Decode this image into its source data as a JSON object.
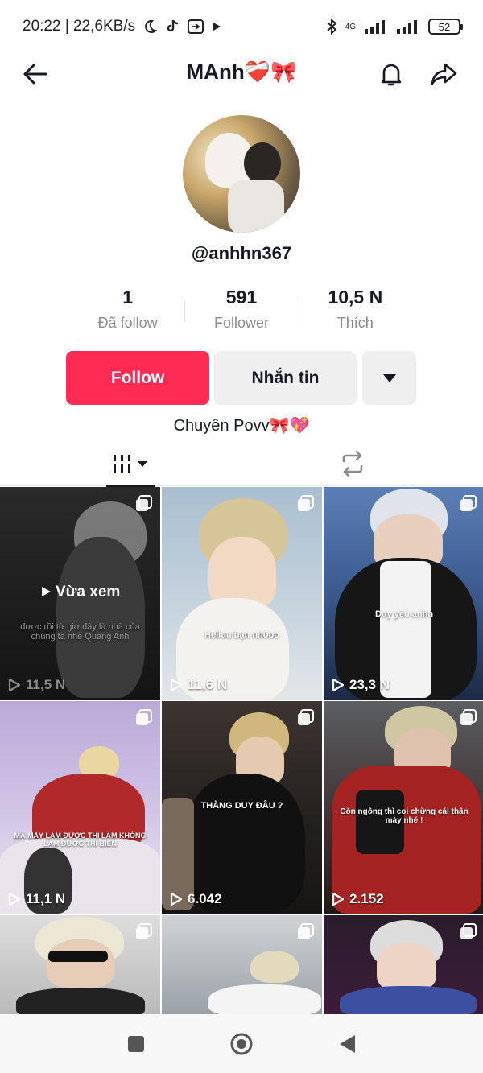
{
  "status_bar": {
    "time_speed": "20:22 | 22,6KB/s",
    "network": "4G",
    "battery": "52"
  },
  "header": {
    "title": "MAnh❤️‍🩹🎀"
  },
  "profile": {
    "handle": "@anhhn367",
    "bio": "Chuyên Povv🎀💖"
  },
  "stats": [
    {
      "value": "1",
      "label": "Đã follow"
    },
    {
      "value": "591",
      "label": "Follower"
    },
    {
      "value": "10,5 N",
      "label": "Thích"
    }
  ],
  "actions": {
    "follow_label": "Follow",
    "message_label": "Nhắn tin"
  },
  "videos": [
    {
      "views": "11,5 N",
      "overlay": "được rồi từ giờ đây là nhà của chúng ta nhé Quang Anh",
      "watched_label": "Vừa xem"
    },
    {
      "views": "11,6 N",
      "overlay": "Helluu bạn nhôoo"
    },
    {
      "views": "23,3 N",
      "overlay": "Duy yêu anhh"
    },
    {
      "views": "11,1 N",
      "overlay": "MÀ MẤY LÀM ĐƯỢC THÌ LÀM KHÔNG LÀM ĐƯỢC THÌ BIẾN"
    },
    {
      "views": "6.042",
      "overlay": "THẰNG DUY ĐÂU ?"
    },
    {
      "views": "2.152",
      "overlay": "Còn ngông thì coi chừng cái thân mày nhé !"
    },
    {
      "views": "",
      "overlay": ""
    },
    {
      "views": "",
      "overlay": ""
    },
    {
      "views": "",
      "overlay": ""
    }
  ],
  "icons": {
    "back": "back-arrow-icon",
    "bell": "bell-icon",
    "share": "share-icon",
    "dropdown": "caret-down-icon",
    "grid_tab": "grid-icon",
    "repost_tab": "repost-icon",
    "play": "play-icon",
    "multi": "multi-photo-icon"
  },
  "colors": {
    "follow": "#fe2c55",
    "secondary_button": "#efeff0",
    "muted_text": "#8a8b91"
  }
}
